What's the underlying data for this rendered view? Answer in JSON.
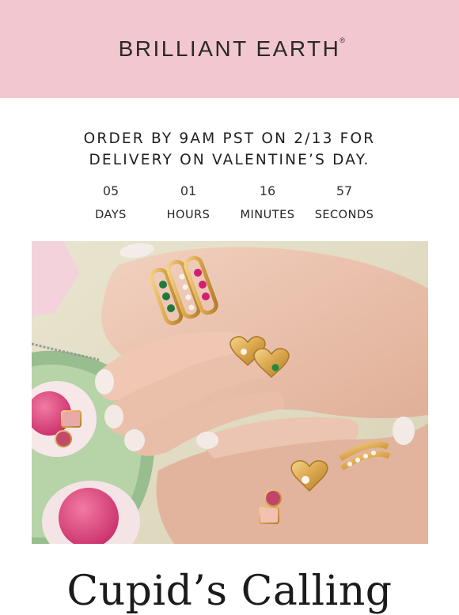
{
  "header": {
    "brand": "BRILLIANT EARTH",
    "trademark": "®",
    "bg_color": "#f2c7d0"
  },
  "promo": {
    "line1": "ORDER BY 9AM PST ON 2/13 FOR",
    "line2": "DELIVERY ON VALENTINE’S DAY."
  },
  "countdown": {
    "days": {
      "value": "05",
      "label": "DAYS"
    },
    "hours": {
      "value": "01",
      "label": "HOURS"
    },
    "minutes": {
      "value": "16",
      "label": "MINUTES"
    },
    "seconds": {
      "value": "57",
      "label": "SECONDS"
    }
  },
  "hero": {
    "alt": "Hands wearing gold heart rings with pink and green gemstones beside a pink candy tray"
  },
  "headline": "Cupid’s Calling"
}
